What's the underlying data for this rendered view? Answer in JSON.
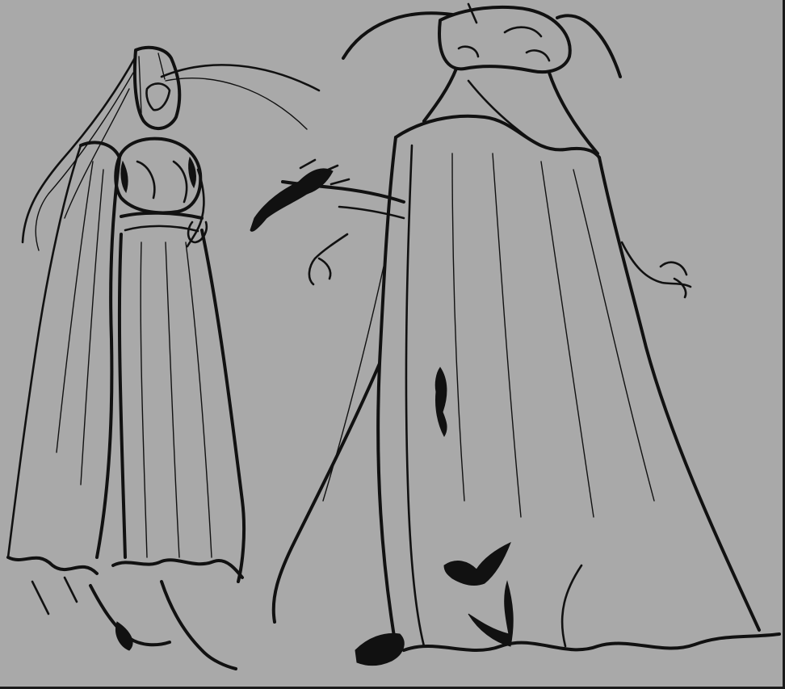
{
  "canvas": {
    "background_color": "#a9a9a9",
    "ink_color": "#111111"
  },
  "figures": [
    {
      "name": "robed-figure-front-view"
    },
    {
      "name": "caped-figure-back-view"
    }
  ]
}
